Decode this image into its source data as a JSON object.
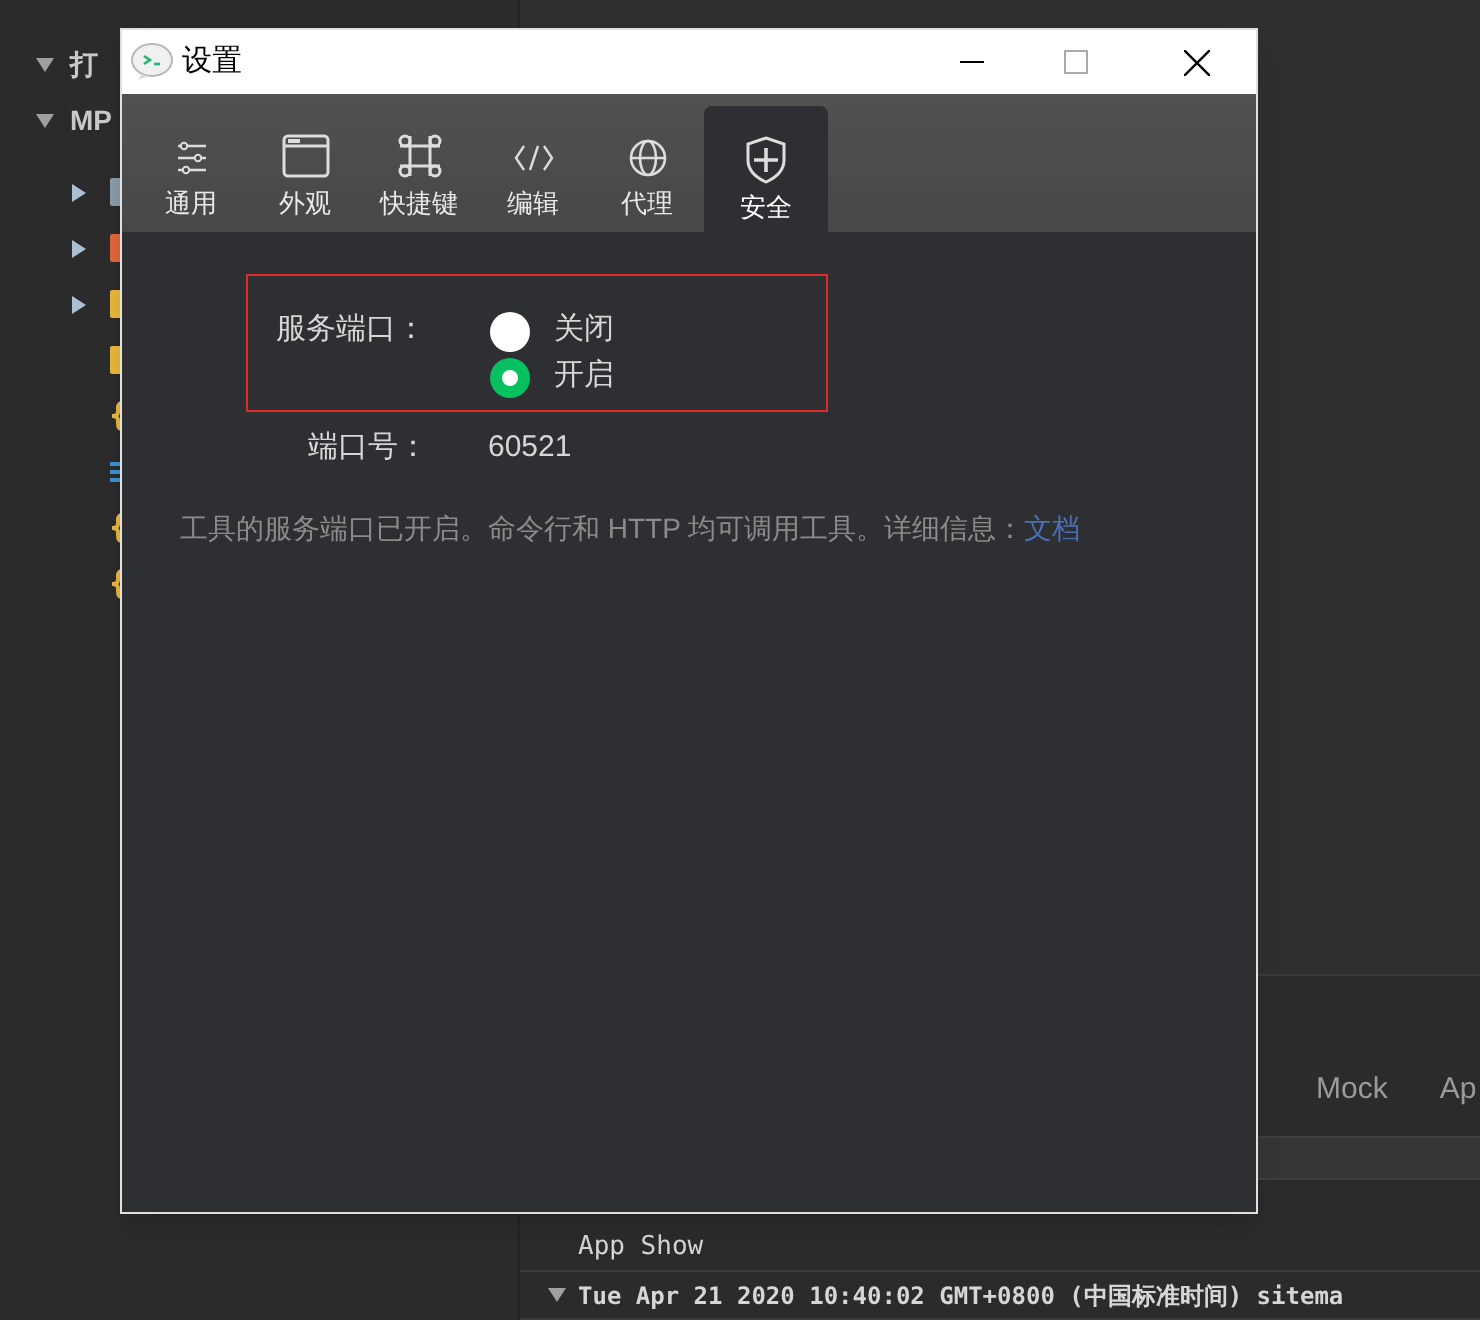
{
  "sidebar": {
    "sections": [
      {
        "label": "打",
        "expanded": true
      },
      {
        "label": "MP",
        "expanded": true
      }
    ],
    "items": [
      {
        "kind": "folder",
        "color": "#8a9aa8"
      },
      {
        "kind": "folder",
        "color": "#e0633a"
      },
      {
        "kind": "folder",
        "color": "#e5b53a"
      },
      {
        "kind": "file",
        "color": "#e5b53a"
      },
      {
        "kind": "json",
        "color": "#e5b53a"
      },
      {
        "kind": "config",
        "color": "#3c8fd6"
      },
      {
        "kind": "json",
        "color": "#e5b53a"
      },
      {
        "kind": "json",
        "color": "#e5b53a"
      }
    ]
  },
  "bottom_panel": {
    "tabs": [
      "Mock",
      "Ap"
    ],
    "console": [
      {
        "kind": "line",
        "text": "App Show"
      },
      {
        "kind": "group",
        "expanded": true,
        "text": "Tue Apr 21 2020 10:40:02 GMT+0800 (中国标准时间) sitema"
      }
    ]
  },
  "window": {
    "title": "设置"
  },
  "tabs": [
    {
      "label": "通用",
      "selected": false
    },
    {
      "label": "外观",
      "selected": false
    },
    {
      "label": "快捷键",
      "selected": false
    },
    {
      "label": "编辑",
      "selected": false
    },
    {
      "label": "代理",
      "selected": false
    },
    {
      "label": "安全",
      "selected": true
    }
  ],
  "service_port": {
    "label": "服务端口：",
    "options": [
      {
        "label": "关闭",
        "selected": false
      },
      {
        "label": "开启",
        "selected": true
      }
    ]
  },
  "port": {
    "label": "端口号：",
    "value": "60521"
  },
  "description": {
    "text": "工具的服务端口已开启。命令行和 HTTP 均可调用工具。详细信息：",
    "link": "文档"
  }
}
